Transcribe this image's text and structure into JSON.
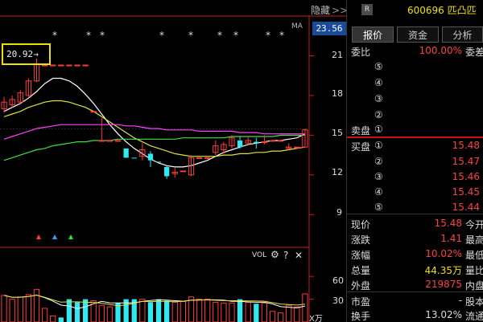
{
  "toolbar": {
    "hide_label": "隐藏",
    "hide_arrows": ">>"
  },
  "stock": {
    "badge": "R",
    "code_name": "600696 匹凸匹"
  },
  "tabs": [
    {
      "label": "报价",
      "active": true
    },
    {
      "label": "资金",
      "active": false
    },
    {
      "label": "分析",
      "active": false
    }
  ],
  "price_axis": {
    "current": "23.56",
    "ticks": [
      "21",
      "18",
      "15",
      "12",
      "9"
    ]
  },
  "ma_label": "MA",
  "callout": {
    "value": "20.92",
    "arrow": "→"
  },
  "markers": [
    "*",
    "*",
    "*",
    "*",
    "*",
    "*",
    "*",
    "*",
    "*",
    "*"
  ],
  "volume_panel": {
    "label": "VOL",
    "ticks": [
      "60",
      "30"
    ],
    "unit": "X万",
    "icons": [
      "gear-icon",
      "help-icon",
      "close-icon"
    ]
  },
  "quote": {
    "weibi_label": "委比",
    "weibi_value": "100.00%",
    "weibi_suffix": "委差",
    "sell_label": "卖盘",
    "buy_label": "买盘",
    "sell_levels": [
      "⑤",
      "④",
      "③",
      "②",
      "①"
    ],
    "buy_levels": [
      {
        "num": "①",
        "price": "15.48"
      },
      {
        "num": "②",
        "price": "15.47"
      },
      {
        "num": "③",
        "price": "15.46"
      },
      {
        "num": "④",
        "price": "15.45"
      },
      {
        "num": "⑤",
        "price": "15.44"
      }
    ],
    "stats": [
      {
        "label": "现价",
        "value": "15.48",
        "suffix": "今开"
      },
      {
        "label": "涨跌",
        "value": "1.41",
        "suffix": "最高"
      },
      {
        "label": "涨幅",
        "value": "10.02%",
        "suffix": "最低"
      },
      {
        "label": "总量",
        "value": "44.35万",
        "suffix": "量比"
      },
      {
        "label": "外盘",
        "value": "219875",
        "suffix": "内盘"
      }
    ],
    "extra": [
      {
        "label": "市盈",
        "value": "-",
        "suffix": "股本"
      },
      {
        "label": "换手",
        "value": "13.02%",
        "suffix": "流通"
      }
    ]
  },
  "chart_data": {
    "type": "candlestick",
    "ylim": [
      7.5,
      24
    ],
    "candles": [
      {
        "o": 17.0,
        "c": 17.5,
        "h": 17.9,
        "l": 16.7,
        "up": true
      },
      {
        "o": 17.3,
        "c": 17.7,
        "h": 18.0,
        "l": 17.1,
        "up": true
      },
      {
        "o": 17.5,
        "c": 18.2,
        "h": 18.4,
        "l": 17.3,
        "up": true
      },
      {
        "o": 18.0,
        "c": 19.1,
        "h": 19.3,
        "l": 17.9,
        "up": true
      },
      {
        "o": 19.1,
        "c": 20.4,
        "h": 20.8,
        "l": 19.0,
        "up": true
      },
      {
        "o": 20.3,
        "c": 20.3,
        "h": 20.3,
        "l": 20.3,
        "up": true
      },
      {
        "o": 20.3,
        "c": 20.3,
        "h": 20.3,
        "l": 20.3,
        "up": true
      },
      {
        "o": 20.3,
        "c": 20.3,
        "h": 20.3,
        "l": 20.3,
        "up": true
      },
      {
        "o": 20.3,
        "c": 20.3,
        "h": 20.3,
        "l": 20.3,
        "up": true
      },
      {
        "o": 20.3,
        "c": 20.3,
        "h": 20.3,
        "l": 20.3,
        "up": true
      },
      {
        "o": 20.3,
        "c": 20.3,
        "h": 20.3,
        "l": 20.3,
        "up": true
      },
      {
        "o": 16.8,
        "c": 16.8,
        "h": 16.8,
        "l": 16.8,
        "up": true
      },
      {
        "o": 14.6,
        "c": 14.6,
        "h": 16.3,
        "l": 14.6,
        "up": true
      },
      {
        "o": 14.6,
        "c": 14.6,
        "h": 14.6,
        "l": 14.6,
        "up": true
      },
      {
        "o": 14.6,
        "c": 14.6,
        "h": 14.6,
        "l": 14.6,
        "up": true
      },
      {
        "o": 14.0,
        "c": 13.3,
        "h": 14.0,
        "l": 13.3,
        "up": false
      },
      {
        "o": 13.3,
        "c": 13.3,
        "h": 13.3,
        "l": 13.3,
        "up": false
      },
      {
        "o": 13.4,
        "c": 13.9,
        "h": 14.4,
        "l": 13.1,
        "up": true
      },
      {
        "o": 13.6,
        "c": 13.1,
        "h": 13.8,
        "l": 12.6,
        "up": false
      },
      {
        "o": 13.0,
        "c": 13.0,
        "h": 13.0,
        "l": 13.0,
        "up": false
      },
      {
        "o": 12.6,
        "c": 11.9,
        "h": 12.7,
        "l": 11.7,
        "up": false
      },
      {
        "o": 12.1,
        "c": 12.2,
        "h": 12.6,
        "l": 11.8,
        "up": true
      },
      {
        "o": 12.3,
        "c": 12.3,
        "h": 12.3,
        "l": 12.3,
        "up": true
      },
      {
        "o": 12.0,
        "c": 13.3,
        "h": 13.5,
        "l": 11.9,
        "up": true
      },
      {
        "o": 13.3,
        "c": 13.3,
        "h": 13.3,
        "l": 13.3,
        "up": true
      },
      {
        "o": 13.3,
        "c": 13.3,
        "h": 13.3,
        "l": 13.3,
        "up": true
      },
      {
        "o": 13.7,
        "c": 14.2,
        "h": 14.6,
        "l": 13.5,
        "up": true
      },
      {
        "o": 13.9,
        "c": 14.3,
        "h": 14.5,
        "l": 13.6,
        "up": true
      },
      {
        "o": 14.2,
        "c": 14.8,
        "h": 15.0,
        "l": 14.0,
        "up": true
      },
      {
        "o": 14.6,
        "c": 14.1,
        "h": 14.9,
        "l": 14.0,
        "up": false
      },
      {
        "o": 14.4,
        "c": 14.6,
        "h": 14.9,
        "l": 14.2,
        "up": true
      },
      {
        "o": 14.5,
        "c": 14.4,
        "h": 14.8,
        "l": 14.0,
        "up": false
      },
      {
        "o": 14.5,
        "c": 14.5,
        "h": 15.0,
        "l": 14.3,
        "up": true
      },
      {
        "o": 14.6,
        "c": 14.6,
        "h": 14.6,
        "l": 14.6,
        "up": true
      },
      {
        "o": 14.6,
        "c": 14.6,
        "h": 14.6,
        "l": 14.6,
        "up": true
      },
      {
        "o": 14.1,
        "c": 14.0,
        "h": 14.4,
        "l": 13.9,
        "up": true
      },
      {
        "o": 14.1,
        "c": 14.1,
        "h": 14.1,
        "l": 14.1,
        "up": true
      },
      {
        "o": 14.1,
        "c": 15.4,
        "h": 15.5,
        "l": 14.1,
        "up": true
      }
    ],
    "ma_series": [
      {
        "color": "#ffffff",
        "values": [
          16.8,
          17.1,
          17.4,
          17.8,
          18.3,
          18.9,
          19.3,
          19.3,
          19.1,
          18.7,
          18.1,
          17.4,
          16.6,
          15.8,
          15.1,
          14.5,
          14.0,
          13.6,
          13.2,
          12.9,
          12.7,
          12.6,
          12.6,
          12.7,
          12.9,
          13.1,
          13.4,
          13.7,
          13.9,
          14.1,
          14.3,
          14.4,
          14.5,
          14.6,
          14.6,
          14.7,
          14.8,
          15.1
        ]
      },
      {
        "color": "#e0e040",
        "values": [
          16.4,
          16.6,
          16.8,
          17.1,
          17.3,
          17.5,
          17.6,
          17.6,
          17.5,
          17.3,
          17.1,
          16.8,
          16.4,
          16.0,
          15.6,
          15.2,
          14.8,
          14.5,
          14.2,
          14.0,
          13.8,
          13.6,
          13.5,
          13.4,
          13.4,
          13.4,
          13.4,
          13.5,
          13.5,
          13.6,
          13.6,
          13.7,
          13.7,
          13.8,
          13.8,
          13.9,
          14.0,
          14.1
        ]
      },
      {
        "color": "#ff40ff",
        "values": [
          14.7,
          14.9,
          15.1,
          15.3,
          15.5,
          15.6,
          15.7,
          15.8,
          15.8,
          15.8,
          15.8,
          15.8,
          15.8,
          15.8,
          15.8,
          15.7,
          15.7,
          15.6,
          15.5,
          15.5,
          15.4,
          15.4,
          15.4,
          15.4,
          15.3,
          15.3,
          15.3,
          15.3,
          15.3,
          15.2,
          15.2,
          15.2,
          15.1,
          15.1,
          15.1,
          15.1,
          15.1,
          15.1
        ]
      },
      {
        "color": "#40e040",
        "values": [
          13.1,
          13.3,
          13.5,
          13.7,
          13.9,
          14.0,
          14.2,
          14.3,
          14.4,
          14.5,
          14.5,
          14.6,
          14.6,
          14.6,
          14.7,
          14.7,
          14.7,
          14.7,
          14.7,
          14.7,
          14.7,
          14.7,
          14.8,
          14.8,
          14.8,
          14.8,
          14.8,
          14.8,
          14.9,
          14.9,
          14.9,
          14.9,
          14.9,
          14.9,
          15.0,
          15.0,
          15.0,
          15.0
        ]
      }
    ],
    "volume_ylim": [
      0,
      75
    ],
    "volumes": [
      {
        "v": 35,
        "up": true
      },
      {
        "v": 30,
        "up": true
      },
      {
        "v": 33,
        "up": true
      },
      {
        "v": 36,
        "up": true
      },
      {
        "v": 43,
        "up": true
      },
      {
        "v": 18,
        "up": true
      },
      {
        "v": 8,
        "up": true
      },
      {
        "v": 6,
        "up": false
      },
      {
        "v": 30,
        "up": false
      },
      {
        "v": 26,
        "up": false
      },
      {
        "v": 30,
        "up": false
      },
      {
        "v": 28,
        "up": true
      },
      {
        "v": 22,
        "up": true
      },
      {
        "v": 20,
        "up": true
      },
      {
        "v": 25,
        "up": false
      },
      {
        "v": 30,
        "up": false
      },
      {
        "v": 30,
        "up": false
      },
      {
        "v": 30,
        "up": true
      },
      {
        "v": 26,
        "up": false
      },
      {
        "v": 30,
        "up": false
      },
      {
        "v": 28,
        "up": false
      },
      {
        "v": 26,
        "up": true
      },
      {
        "v": 27,
        "up": true
      },
      {
        "v": 33,
        "up": true
      },
      {
        "v": 30,
        "up": true
      },
      {
        "v": 30,
        "up": true
      },
      {
        "v": 26,
        "up": true
      },
      {
        "v": 25,
        "up": true
      },
      {
        "v": 25,
        "up": true
      },
      {
        "v": 30,
        "up": false
      },
      {
        "v": 26,
        "up": true
      },
      {
        "v": 24,
        "up": false
      },
      {
        "v": 25,
        "up": true
      },
      {
        "v": 14,
        "up": true
      },
      {
        "v": 12,
        "up": true
      },
      {
        "v": 22,
        "up": true
      },
      {
        "v": 20,
        "up": true
      },
      {
        "v": 37,
        "up": true
      }
    ]
  }
}
